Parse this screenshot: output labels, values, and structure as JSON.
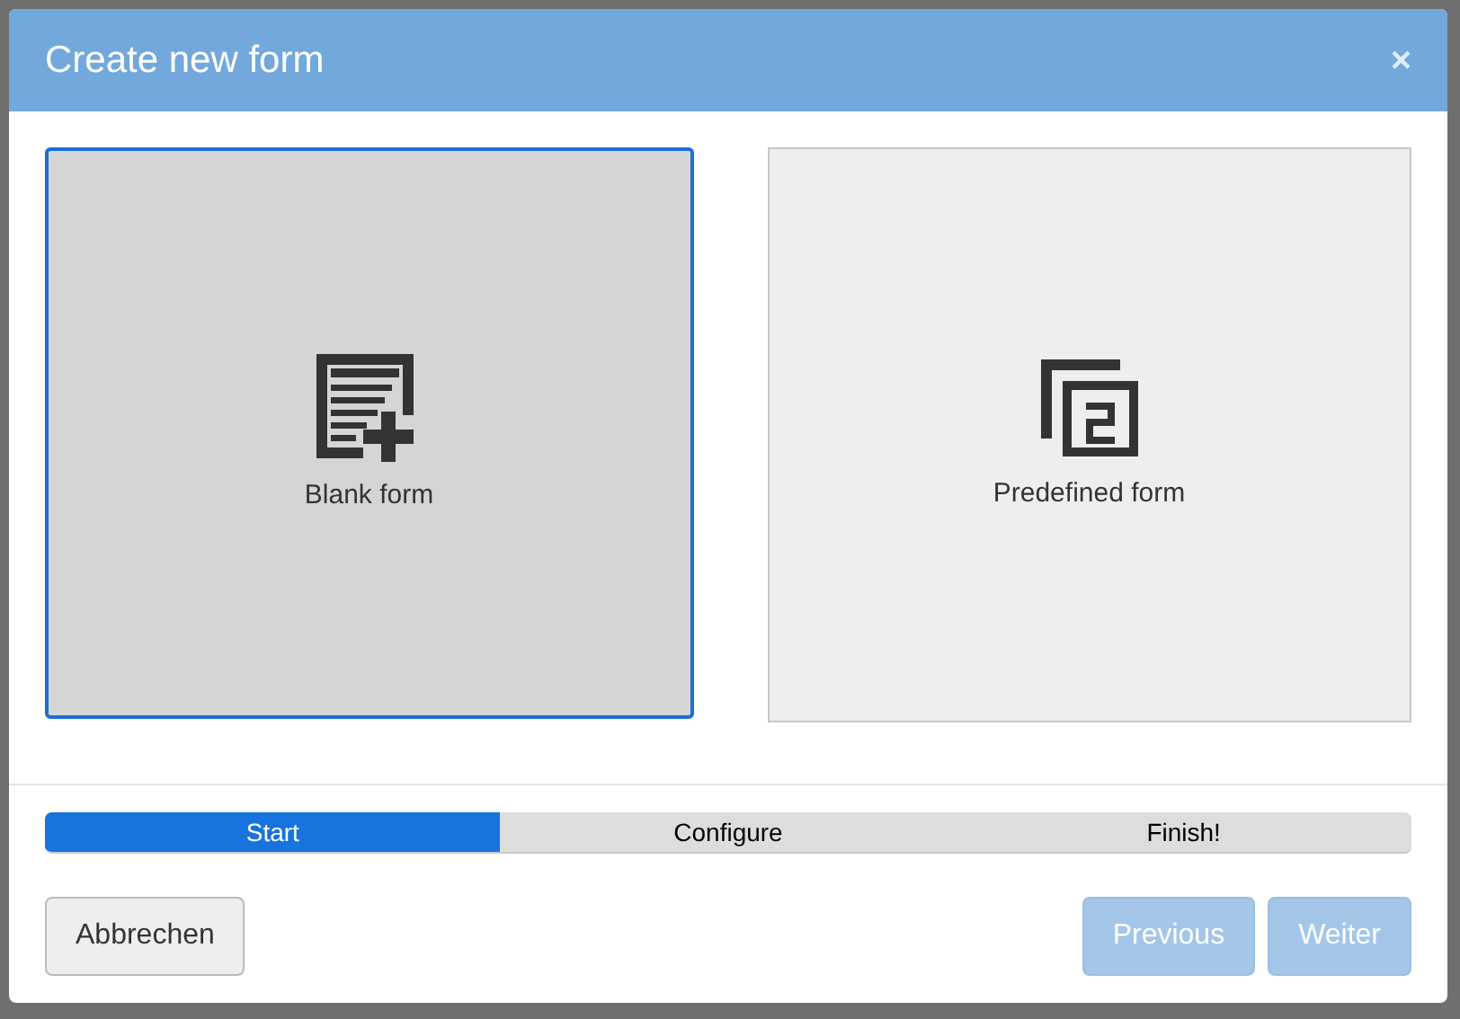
{
  "dialog": {
    "title": "Create new form",
    "close": "×"
  },
  "options": [
    {
      "kind": "blank",
      "label": "Blank form",
      "selected": true
    },
    {
      "kind": "predefined",
      "label": "Predefined form",
      "selected": false
    }
  ],
  "steps": [
    {
      "label": "Start",
      "selected": true
    },
    {
      "label": "Configure",
      "selected": false
    },
    {
      "label": "Finish!",
      "selected": false
    }
  ],
  "buttons": {
    "cancel": {
      "label": "Abbrechen",
      "disabled": false
    },
    "previous": {
      "label": "Previous",
      "disabled": true
    },
    "next": {
      "label": "Weiter",
      "disabled": true
    }
  }
}
